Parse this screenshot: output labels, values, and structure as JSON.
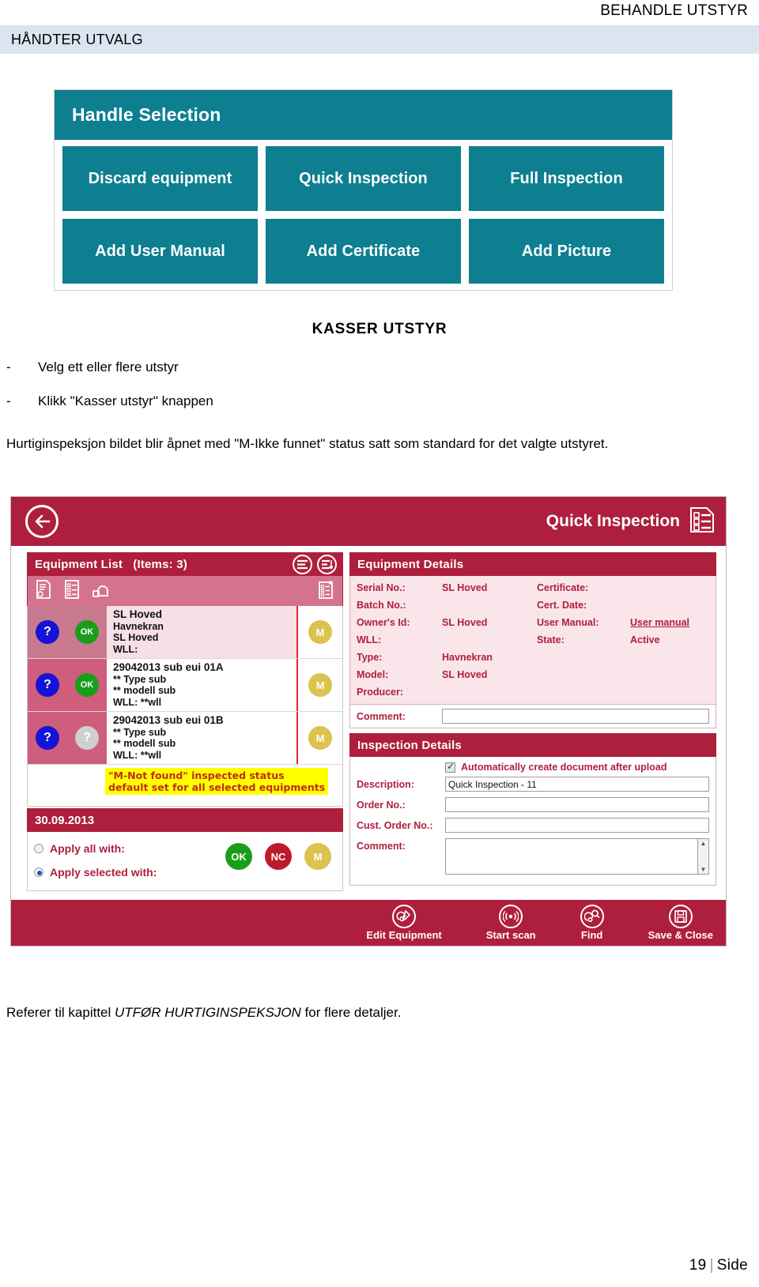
{
  "document": {
    "header_title": "BEHANDLE UTSTYR",
    "banner_title": "HÅNDTER UTVALG",
    "section_title": "KASSER UTSTYR",
    "bullets": [
      {
        "dash": "-",
        "text": "Velg ett eller flere utstyr"
      },
      {
        "dash": "-",
        "text": "Klikk \"Kasser utstyr\" knappen"
      }
    ],
    "paragraph": "Hurtiginspeksjon bildet blir åpnet med  \"M-Ikke funnet\" status satt som standard for det valgte utstyret.",
    "closing_pre": "Referer til kapittel ",
    "closing_em": "UTFØR HURTIGINSPEKSJON",
    "closing_post": " for flere detaljer.",
    "page_number": "19",
    "page_word": "Side"
  },
  "handle_selection": {
    "title": "Handle Selection",
    "accent": "#0d7f91",
    "buttons": [
      "Discard equipment",
      "Quick Inspection",
      "Full Inspection",
      "Add User Manual",
      "Add Certificate",
      "Add Picture"
    ]
  },
  "app": {
    "accent": "#ae1f3d",
    "title": "Quick Inspection",
    "back_icon": "back-arrow-icon",
    "title_icon": "checklist-document-icon",
    "equipment_list": {
      "title": "Equipment List",
      "count_label": "(Items: 3)",
      "header_icons": [
        "list-filter-icon",
        "list-sort-icon"
      ],
      "toolbar_icons": [
        "certificate-icon",
        "checklist-icon",
        "shackle-icon",
        "new-inspection-icon"
      ],
      "rows": [
        {
          "selected": true,
          "status1": "?",
          "status2": "OK",
          "status2_kind": "ok",
          "line1": "SL Hoved",
          "line2": "Havnekran",
          "line3": "SL Hoved",
          "line4": "WLL:",
          "mark": "M"
        },
        {
          "selected": false,
          "status1": "?",
          "status2": "OK",
          "status2_kind": "ok",
          "line1": "29042013 sub eui 01A",
          "line2": "** Type sub",
          "line3": "** modell sub",
          "line4": "WLL: **wll",
          "mark": "M"
        },
        {
          "selected": false,
          "status1": "?",
          "status2": "?",
          "status2_kind": "unknown",
          "line1": "29042013 sub eui 01B",
          "line2": "** Type sub",
          "line3": "** modell sub",
          "line4": "WLL: **wll",
          "mark": "M"
        }
      ],
      "annotation": "\"M-Not found\" inspected status\ndefault set for all selected equipments",
      "annotation_bg": "#ffff00",
      "annotation_color": "#c22b17",
      "date": "30.09.2013",
      "apply_all_label": "Apply all with:",
      "apply_selected_label": "Apply selected with:",
      "apply_all_selected": false,
      "apply_selected_selected": true,
      "apply_buttons": [
        {
          "label": "OK",
          "color": "#1a9e1a"
        },
        {
          "label": "NC",
          "color": "#bf1a2b"
        },
        {
          "label": "M",
          "color": "#dcc24f"
        }
      ]
    },
    "equipment_details": {
      "title": "Equipment Details",
      "fields": [
        {
          "label": "Serial No.:",
          "value": "SL Hoved",
          "label2": "Certificate:",
          "value2": ""
        },
        {
          "label": "Batch No.:",
          "value": "",
          "label2": "Cert. Date:",
          "value2": ""
        },
        {
          "label": "Owner's Id:",
          "value": "SL Hoved",
          "label2": "User Manual:",
          "value2": "User manual",
          "value2_link": true
        },
        {
          "label": "WLL:",
          "value": "",
          "label2": "State:",
          "value2": "Active"
        },
        {
          "label": "Type:",
          "value": "Havnekran",
          "label2": "",
          "value2": ""
        },
        {
          "label": "Model:",
          "value": "SL Hoved",
          "label2": "",
          "value2": ""
        },
        {
          "label": "Producer:",
          "value": "",
          "label2": "",
          "value2": ""
        }
      ],
      "comment_label": "Comment:",
      "comment_value": ""
    },
    "inspection_details": {
      "title": "Inspection Details",
      "auto_create_label": "Automatically create document after upload",
      "auto_create_checked": true,
      "description_label": "Description:",
      "description_value": "Quick Inspection - 11",
      "order_no_label": "Order No.:",
      "order_no_value": "",
      "cust_order_no_label": "Cust. Order No.:",
      "cust_order_no_value": "",
      "comment_label": "Comment:",
      "comment_value": ""
    },
    "footer_buttons": [
      {
        "label": "Edit Equipment",
        "icon": "edit-equipment-icon"
      },
      {
        "label": "Start scan",
        "icon": "rfid-scan-icon"
      },
      {
        "label": "Find",
        "icon": "find-icon"
      },
      {
        "label": "Save & Close",
        "icon": "save-icon"
      }
    ]
  }
}
